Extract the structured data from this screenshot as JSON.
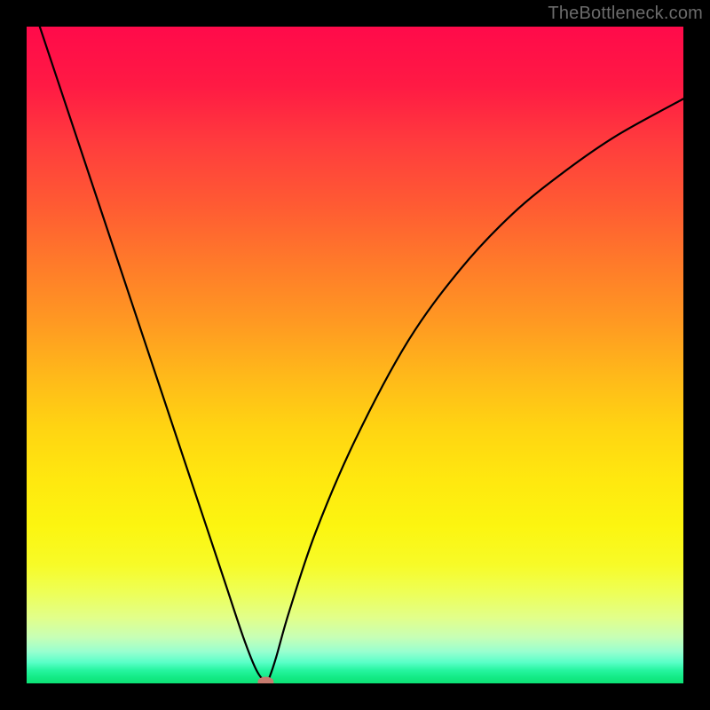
{
  "watermark": "TheBottleneck.com",
  "chart_data": {
    "type": "line",
    "title": "",
    "xlabel": "",
    "ylabel": "",
    "xlim": [
      0,
      100
    ],
    "ylim": [
      0,
      100
    ],
    "grid": false,
    "series": [
      {
        "name": "curve",
        "x": [
          2,
          6,
          10,
          14,
          18,
          22,
          26,
          30,
          33,
          35,
          36.5,
          37,
          38,
          40,
          44,
          50,
          58,
          66,
          74,
          82,
          90,
          100
        ],
        "y": [
          100,
          88,
          76,
          64,
          52,
          40,
          28,
          16,
          7,
          2,
          0.2,
          1,
          4,
          11,
          23,
          37,
          52,
          63,
          71.5,
          78,
          83.5,
          89
        ],
        "color": "#000000"
      }
    ],
    "marker": {
      "x": 36.4,
      "y": 0.2,
      "color": "#c77b6f"
    },
    "background_gradient": {
      "stops": [
        {
          "pos": 0,
          "color": "#ff0a4a"
        },
        {
          "pos": 50,
          "color": "#ffb01c"
        },
        {
          "pos": 82,
          "color": "#f7fb28"
        },
        {
          "pos": 100,
          "color": "#0de275"
        }
      ]
    }
  }
}
